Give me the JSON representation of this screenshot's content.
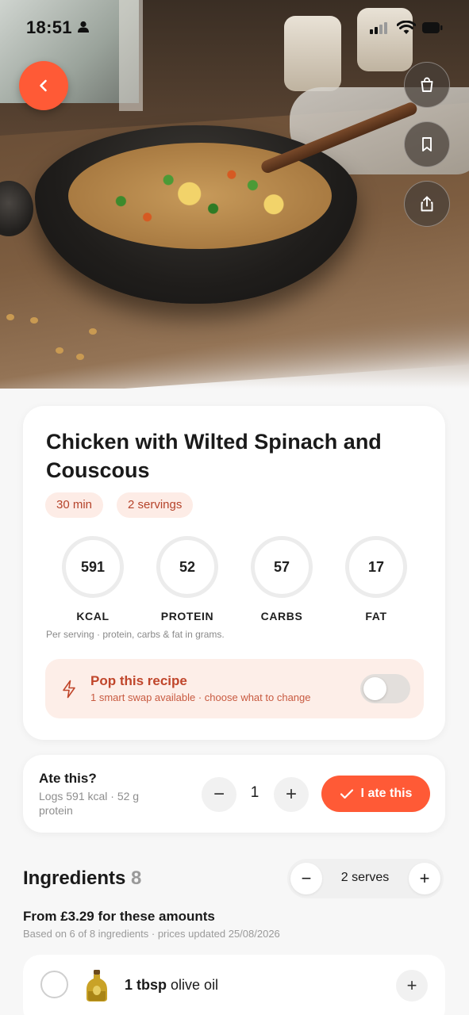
{
  "status_bar": {
    "time": "18:51"
  },
  "hero": {
    "image_alt": "Bowl of fried rice with peas, carrots and egg"
  },
  "recipe": {
    "title": "Chicken with Wilted Spinach and Couscous",
    "time": "30 min",
    "servings": "2 servings",
    "macros": [
      {
        "value": "591",
        "label": "KCAL"
      },
      {
        "value": "52",
        "label": "PROTEIN"
      },
      {
        "value": "57",
        "label": "CARBS"
      },
      {
        "value": "17",
        "label": "FAT"
      }
    ],
    "note": "Per serving · protein, carbs & fat in grams.",
    "pop": {
      "title": "Pop this recipe",
      "subtitle": "1 smart swap available · choose what to change",
      "toggle_on": false
    }
  },
  "ate": {
    "question": "Ate this?",
    "subtitle": "Logs 591 kcal · 52 g protein",
    "quantity": "1",
    "minus": "−",
    "plus": "+",
    "button": "I ate this"
  },
  "ingredients": {
    "title": "Ingredients",
    "count": "8",
    "serves_label": "2 serves",
    "minus": "−",
    "plus": "+",
    "price": "From £3.29 for these amounts",
    "price_note": "Based on 6 of 8 ingredients · prices updated 25/08/2026",
    "items": [
      {
        "qty": "1 tbsp",
        "name": "olive oil",
        "icon": "olive-oil-bottle-icon",
        "add": "+"
      }
    ]
  },
  "colors": {
    "accent": "#ff5a36",
    "pill_bg": "#fdece6",
    "pill_text": "#b5432a"
  }
}
